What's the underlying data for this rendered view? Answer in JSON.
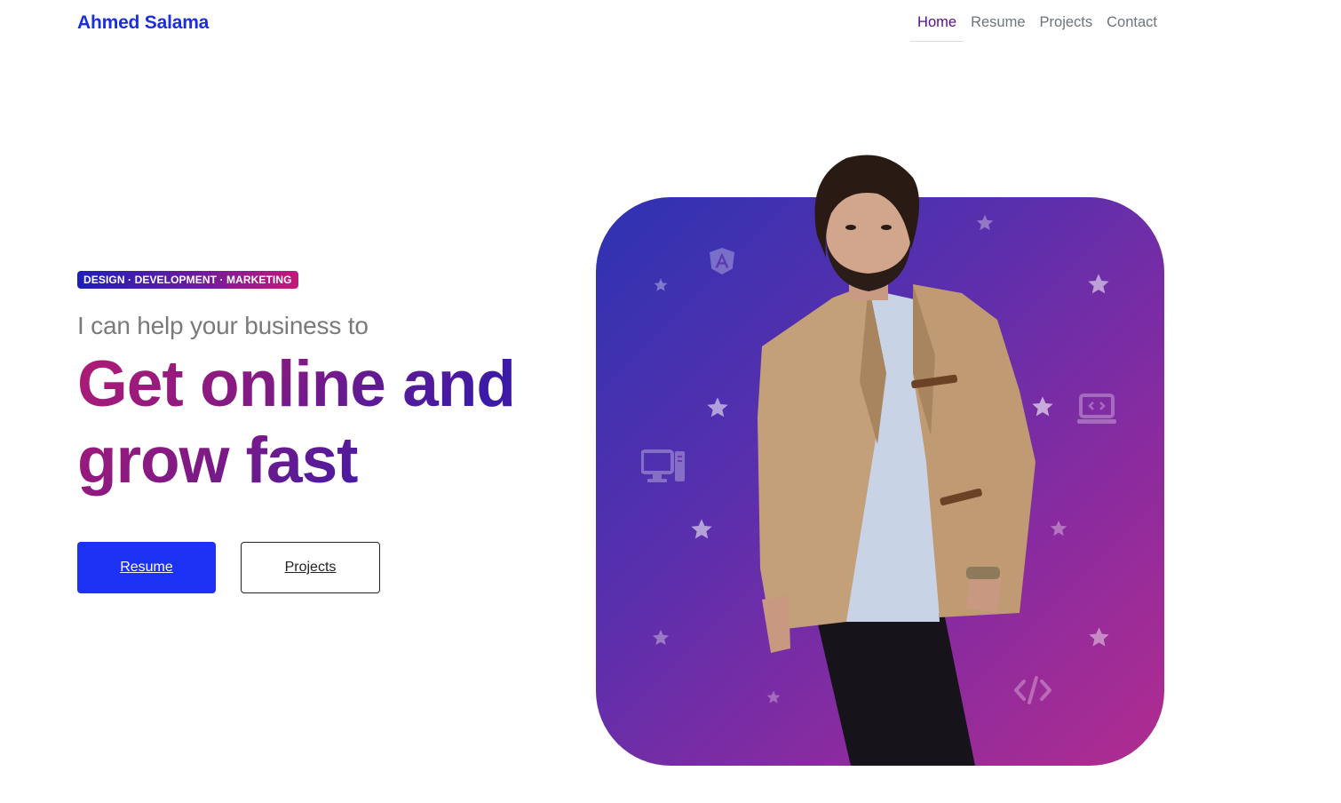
{
  "navbar": {
    "brand": "Ahmed Salama",
    "links": [
      {
        "label": "Home",
        "active": true
      },
      {
        "label": "Resume",
        "active": false
      },
      {
        "label": "Projects",
        "active": false
      },
      {
        "label": "Contact",
        "active": false
      }
    ]
  },
  "hero": {
    "badge": "DESIGN · DEVELOPMENT · MARKETING",
    "lead": "I can help your business to",
    "headline": "Get online and grow fast",
    "buttons": {
      "primary": "Resume",
      "secondary": "Projects"
    }
  },
  "colors": {
    "brand": "#1b2ee0",
    "primary_button": "#1e32f5",
    "active_link": "#5b0f8a",
    "card_gradient_start": "#2d33b2",
    "card_gradient_end": "#b12c8f"
  },
  "icons": [
    "star-icon",
    "angular-icon",
    "desktop-computer-icon",
    "laptop-code-icon",
    "code-brackets-icon"
  ]
}
